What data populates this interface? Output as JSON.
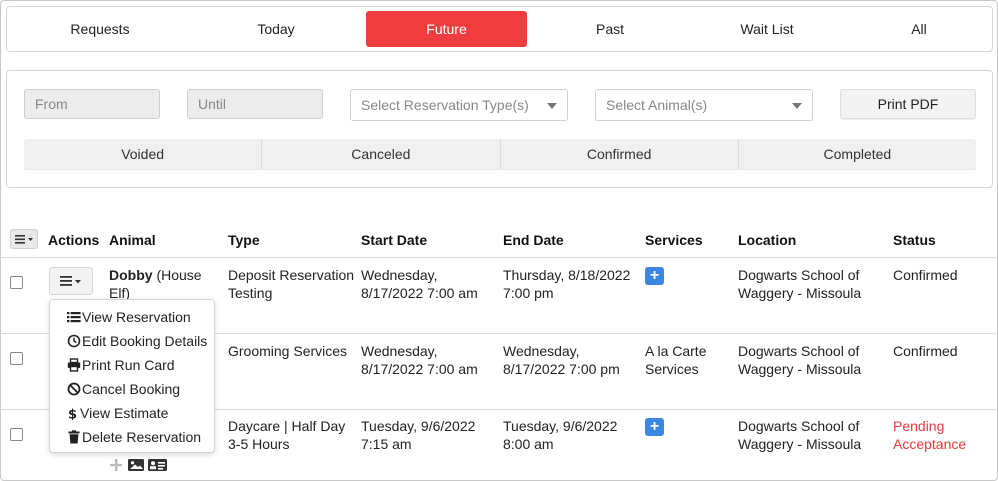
{
  "tabs": [
    {
      "label": "Requests",
      "active": false
    },
    {
      "label": "Today",
      "active": false
    },
    {
      "label": "Future",
      "active": true
    },
    {
      "label": "Past",
      "active": false
    },
    {
      "label": "Wait List",
      "active": false
    },
    {
      "label": "All",
      "active": false
    }
  ],
  "filters": {
    "from_placeholder": "From",
    "until_placeholder": "Until",
    "reservation_type_placeholder": "Select Reservation Type(s)",
    "animal_placeholder": "Select Animal(s)",
    "print_label": "Print PDF",
    "statuses": [
      "Voided",
      "Canceled",
      "Confirmed",
      "Completed"
    ]
  },
  "table": {
    "headers": {
      "actions": "Actions",
      "animal": "Animal",
      "type": "Type",
      "start": "Start Date",
      "end": "End Date",
      "services": "Services",
      "location": "Location",
      "status": "Status"
    },
    "rows": [
      {
        "animal_name": "Dobby",
        "animal_extra": " (House",
        "animal_extra2": "Elf)",
        "type1": "Deposit Reservation",
        "type2": "Testing",
        "start1": "Wednesday,",
        "start2": "8/17/2022 7:00 am",
        "end1": "Thursday, 8/18/2022",
        "end2": "7:00 pm",
        "services": "",
        "loc1": "Dogwarts School of",
        "loc2": "Waggery - Missoula",
        "status1": "Confirmed",
        "status2": ""
      },
      {
        "animal_name": "",
        "animal_extra": "",
        "animal_extra2": "",
        "type1": "Grooming Services",
        "type2": "",
        "start1": "Wednesday,",
        "start2": "8/17/2022 7:00 am",
        "end1": "Wednesday,",
        "end2": "8/17/2022 7:00 pm",
        "services1": "A la Carte",
        "services2": "Services",
        "loc1": "Dogwarts School of",
        "loc2": "Waggery - Missoula",
        "status1": "Confirmed",
        "status2": ""
      },
      {
        "animal_name": "",
        "animal_extra": "",
        "animal_extra2": "",
        "type1": "Daycare | Half Day",
        "type2": "3-5 Hours",
        "start1": "Tuesday, 9/6/2022",
        "start2": "7:15 am",
        "end1": "Tuesday, 9/6/2022",
        "end2": "8:00 am",
        "services": "",
        "loc1": "Dogwarts School of",
        "loc2": "Waggery - Missoula",
        "status1": "Pending",
        "status2": "Acceptance"
      }
    ]
  },
  "action_menu": [
    {
      "label": "View Reservation",
      "icon": "list-icon"
    },
    {
      "label": "Edit Booking Details",
      "icon": "clock-icon"
    },
    {
      "label": "Print Run Card",
      "icon": "printer-icon"
    },
    {
      "label": "Cancel Booking",
      "icon": "ban-icon"
    },
    {
      "label": "View Estimate",
      "icon": "dollar-icon"
    },
    {
      "label": "Delete Reservation",
      "icon": "trash-icon"
    }
  ],
  "colors": {
    "accent": "#f13c3f",
    "services_button": "#3b86e0",
    "pending": "#e53a3a"
  }
}
